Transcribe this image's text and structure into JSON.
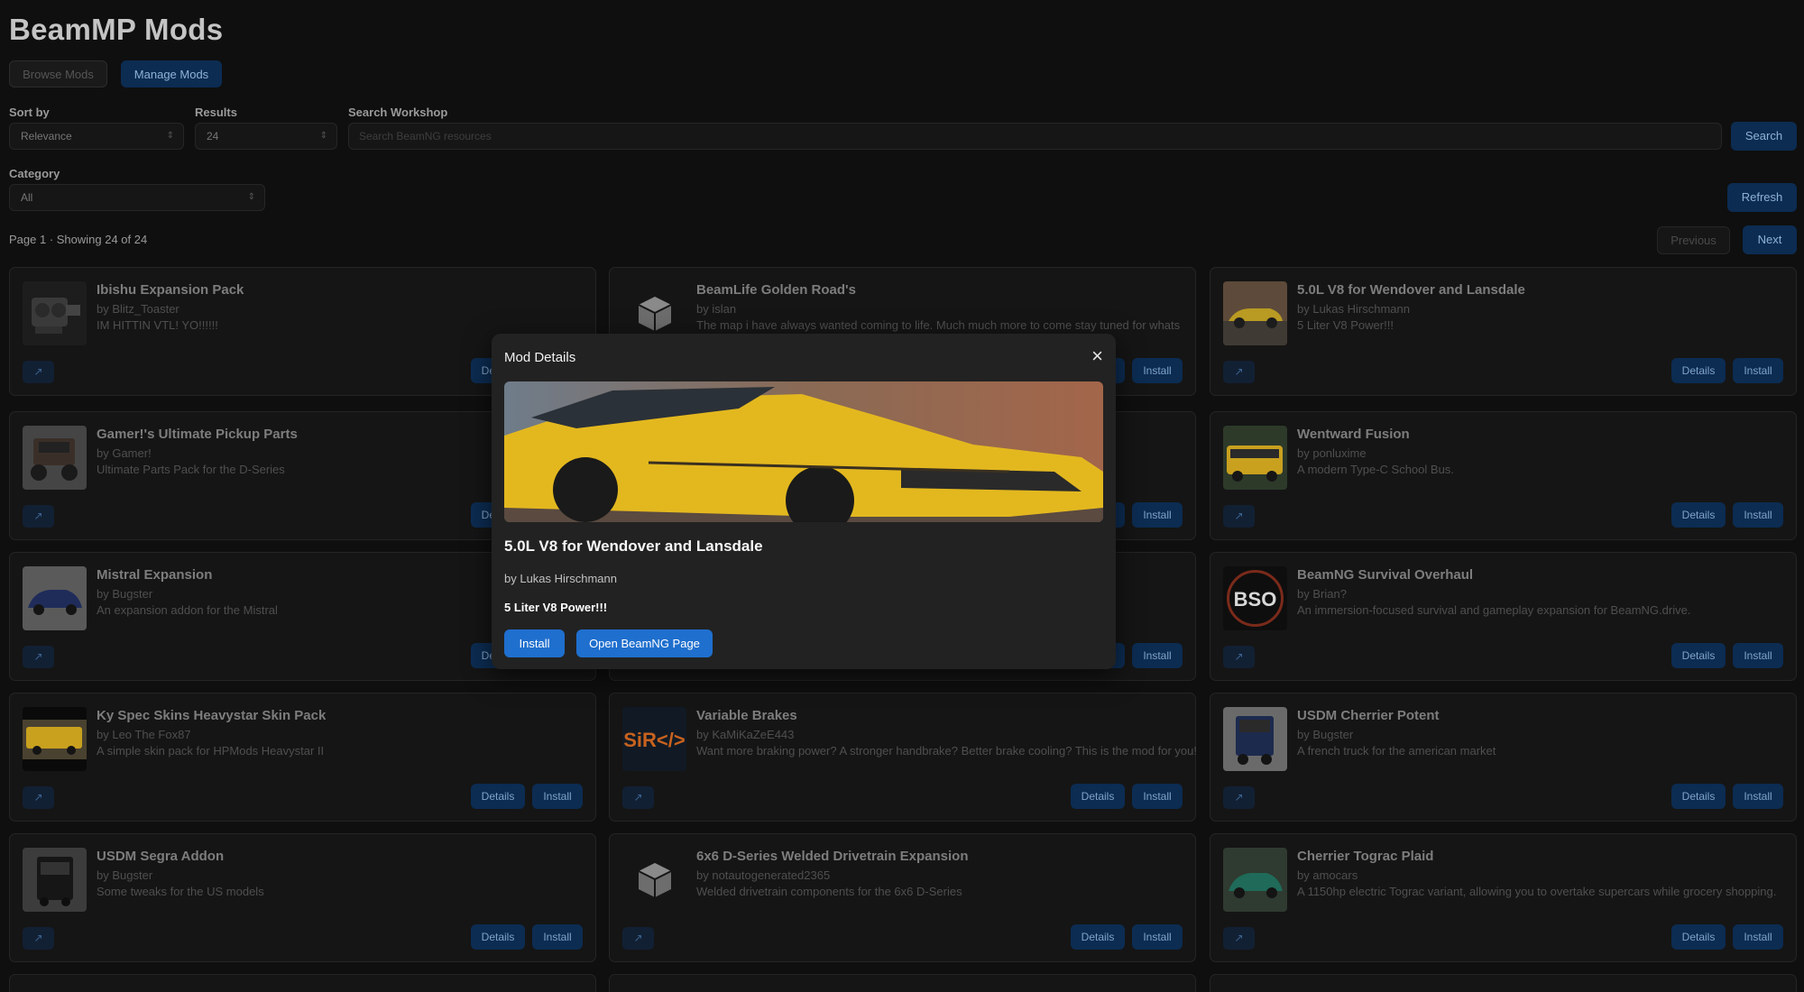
{
  "app": {
    "title": "BeamMP Mods"
  },
  "tabs": {
    "browse": "Browse Mods",
    "manage": "Manage Mods"
  },
  "filters": {
    "sort_label": "Sort by",
    "sort_value": "Relevance",
    "results_label": "Results",
    "results_value": "24",
    "search_label": "Search Workshop",
    "search_placeholder": "Search BeamNG resources",
    "search_button": "Search",
    "category_label": "Category",
    "category_value": "All",
    "refresh_button": "Refresh"
  },
  "pagination": {
    "info": "Page 1 · Showing 24 of 24",
    "previous": "Previous",
    "next": "Next"
  },
  "card_buttons": {
    "details": "Details",
    "install": "Install",
    "link_icon": "↗"
  },
  "mods": [
    {
      "title": "Ibishu Expansion Pack",
      "author": "by Blitz_Toaster",
      "desc": "IM HITTIN VTL! YO!!!!!!",
      "thumb": "engine"
    },
    {
      "title": "BeamLife Golden Road's",
      "author": "by islan",
      "desc": "The map i have always wanted coming to life. Much much more to come stay tuned for whats",
      "thumb": "box-icon"
    },
    {
      "title": "5.0L V8 for Wendover and Lansdale",
      "author": "by Lukas Hirschmann",
      "desc": "5 Liter V8 Power!!!",
      "thumb": "yellow-car"
    },
    {
      "title": "Gamer!'s Ultimate Pickup Parts",
      "author": "by Gamer!",
      "desc": "Ultimate Parts Pack for the D-Series",
      "thumb": "truck"
    },
    {
      "title": "",
      "author": "",
      "desc": "",
      "thumb": ""
    },
    {
      "title": "Wentward Fusion",
      "author": "by ponluxime",
      "desc": "A modern Type-C School Bus.",
      "thumb": "bus"
    },
    {
      "title": "Mistral Expansion",
      "author": "by Bugster",
      "desc": "An expansion addon for the Mistral",
      "thumb": "blue-car"
    },
    {
      "title": "",
      "author": "",
      "desc": "",
      "thumb": ""
    },
    {
      "title": "BeamNG Survival Overhaul",
      "author": "by Brian?",
      "desc": "An immersion-focused survival and gameplay expansion for BeamNG.drive.",
      "thumb": "bso"
    },
    {
      "title": "Ky Spec Skins Heavystar Skin Pack",
      "author": "by Leo The Fox87",
      "desc": "A simple skin pack for HPMods Heavystar II",
      "thumb": "yellow-bus"
    },
    {
      "title": "Variable Brakes",
      "author": "by KaMiKaZeE443",
      "desc": "Want more braking power? A stronger handbrake? Better brake cooling? This is the mod for you!",
      "thumb": "sir"
    },
    {
      "title": "USDM Cherrier Potent",
      "author": "by Bugster",
      "desc": "A french truck for the american market",
      "thumb": "blue-truck"
    },
    {
      "title": "USDM Segra Addon",
      "author": "by Bugster",
      "desc": "Some tweaks for the US models",
      "thumb": "black-truck"
    },
    {
      "title": "6x6 D-Series Welded Drivetrain Expansion",
      "author": "by notautogenerated2365",
      "desc": "Welded drivetrain components for the 6x6 D-Series",
      "thumb": "box-icon"
    },
    {
      "title": "Cherrier Tograc Plaid",
      "author": "by amocars",
      "desc": "A 1150hp electric Tograc variant, allowing you to overtake supercars while grocery shopping.",
      "thumb": "green-car"
    }
  ],
  "modal": {
    "heading": "Mod Details",
    "close": "×",
    "name": "5.0L V8 for Wendover and Lansdale",
    "author": "by Lukas Hirschmann",
    "desc": "5 Liter V8 Power!!!",
    "install": "Install",
    "open_page": "Open BeamNG Page"
  },
  "colors": {
    "accent": "#1f6fce",
    "accent_dim": "#0c2c52",
    "background": "#0f0f0f",
    "card": "#151515"
  }
}
